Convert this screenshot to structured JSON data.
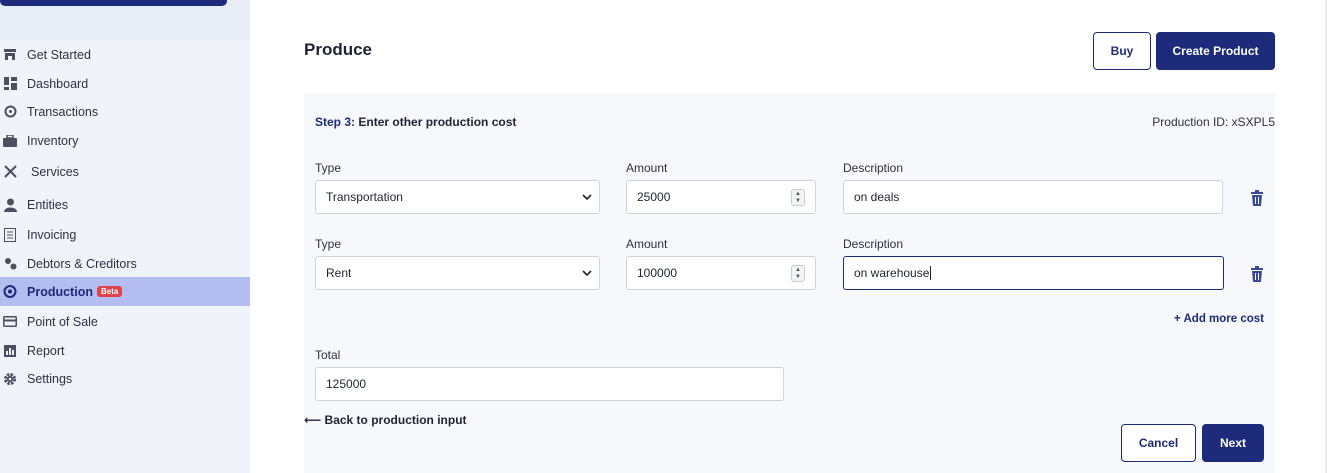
{
  "sidebar": {
    "items": [
      {
        "label": "Get Started",
        "icon": "storefront-icon"
      },
      {
        "label": "Dashboard",
        "icon": "dashboard-icon"
      },
      {
        "label": "Transactions",
        "icon": "transactions-icon"
      },
      {
        "label": "Inventory",
        "icon": "briefcase-icon"
      },
      {
        "label": "Services",
        "icon": "tools-icon"
      },
      {
        "label": "Entities",
        "icon": "person-icon"
      },
      {
        "label": "Invoicing",
        "icon": "invoice-icon"
      },
      {
        "label": "Debtors & Creditors",
        "icon": "debtors-icon"
      },
      {
        "label": "Production",
        "icon": "production-icon",
        "badge": "Beta",
        "active": true
      },
      {
        "label": "Point of Sale",
        "icon": "card-icon"
      },
      {
        "label": "Report",
        "icon": "report-icon"
      },
      {
        "label": "Settings",
        "icon": "gear-icon"
      }
    ]
  },
  "header": {
    "title": "Produce",
    "buy_label": "Buy",
    "create_label": "Create Product"
  },
  "step": {
    "number": "Step 3:",
    "text": "Enter other production cost",
    "production_id": "Production ID: xSXPL5"
  },
  "costs": [
    {
      "type_label": "Type",
      "type_value": "Transportation",
      "amount_label": "Amount",
      "amount_value": "25000",
      "desc_label": "Description",
      "desc_value": "on deals"
    },
    {
      "type_label": "Type",
      "type_value": "Rent",
      "amount_label": "Amount",
      "amount_value": "100000",
      "desc_label": "Description",
      "desc_value": "on warehouse"
    }
  ],
  "add_more_label": "+ Add more cost",
  "total": {
    "label": "Total",
    "value": "125000"
  },
  "back_label": "⟵ Back to production input",
  "footer": {
    "cancel_label": "Cancel",
    "next_label": "Next"
  },
  "colors": {
    "accent": "#1d2b7a",
    "active_nav": "#b3bdf0",
    "badge": "#e0434b"
  }
}
